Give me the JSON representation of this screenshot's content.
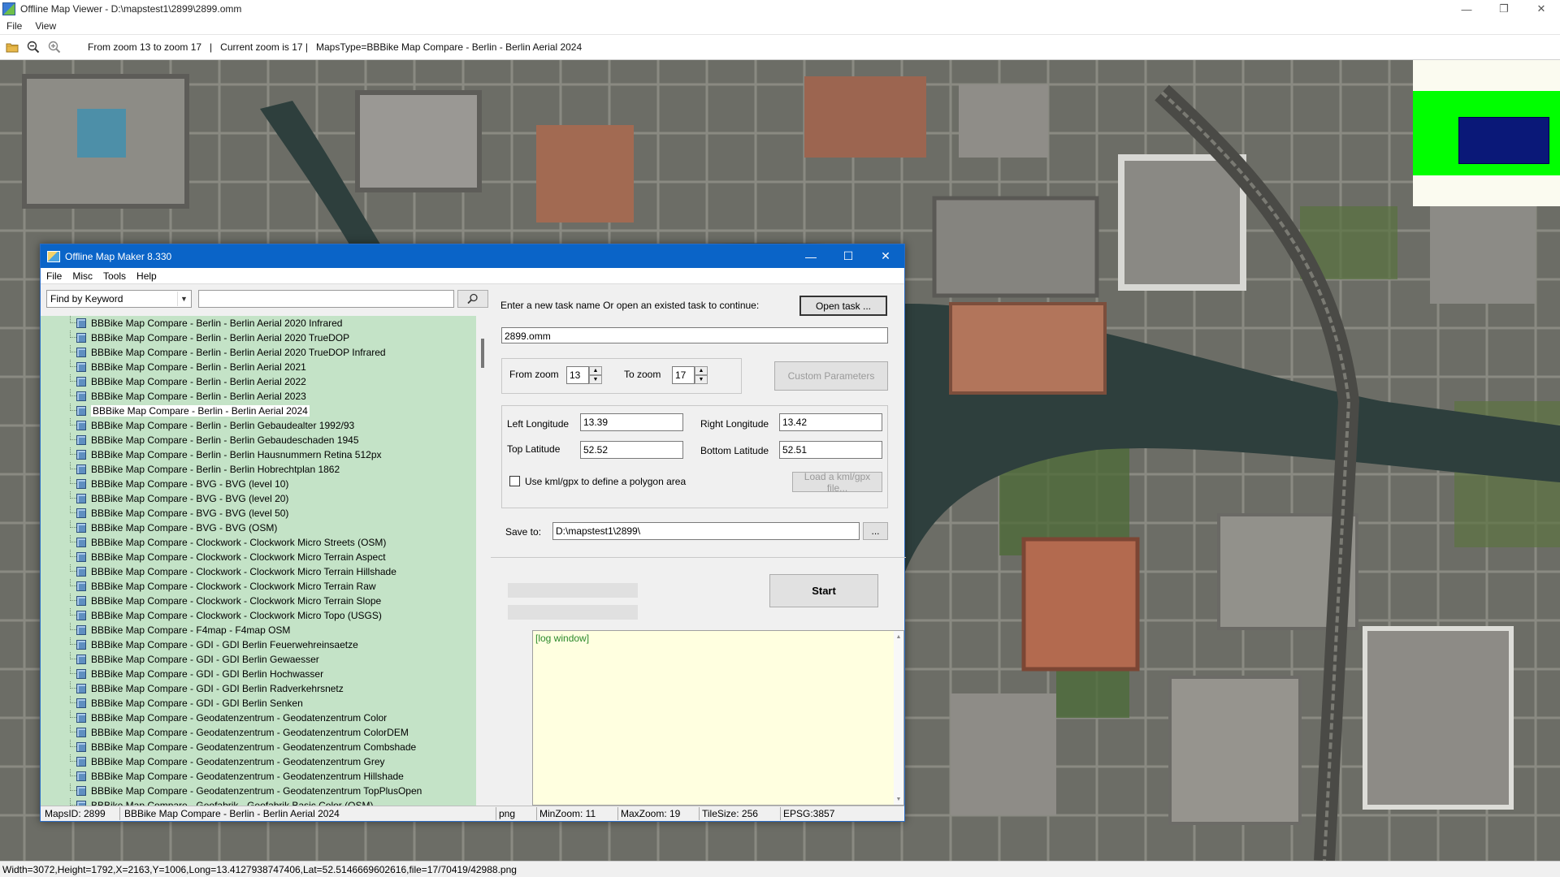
{
  "viewer": {
    "title": "Offline Map Viewer - D:\\mapstest1\\2899\\2899.omm",
    "menu": [
      "File",
      "View"
    ],
    "toolbar_info": "From zoom 13 to zoom 17   |   Current zoom is 17 |   MapsType=BBBike Map Compare - Berlin - Berlin Aerial 2024",
    "status": "Width=3072,Height=1792,X=2163,Y=1006,Long=13.4127938747406,Lat=52.5146669602616,file=17/70419/42988.png"
  },
  "dialog": {
    "title": "Offline Map Maker 8.330",
    "menu": [
      "File",
      "Misc",
      "Tools",
      "Help"
    ],
    "search": {
      "mode": "Find by Keyword",
      "value": ""
    },
    "tree_items": [
      "BBBike Map Compare - Berlin - Berlin Aerial 2020 Infrared",
      "BBBike Map Compare - Berlin - Berlin Aerial 2020 TrueDOP",
      "BBBike Map Compare - Berlin - Berlin Aerial 2020 TrueDOP Infrared",
      "BBBike Map Compare - Berlin - Berlin Aerial 2021",
      "BBBike Map Compare - Berlin - Berlin Aerial 2022",
      "BBBike Map Compare - Berlin - Berlin Aerial 2023",
      "BBBike Map Compare - Berlin - Berlin Aerial 2024",
      "BBBike Map Compare - Berlin - Berlin Gebaudealter 1992/93",
      "BBBike Map Compare - Berlin - Berlin Gebaudeschaden 1945",
      "BBBike Map Compare - Berlin - Berlin Hausnummern Retina 512px",
      "BBBike Map Compare - Berlin - Berlin Hobrechtplan 1862",
      "BBBike Map Compare - BVG - BVG (level 10)",
      "BBBike Map Compare - BVG - BVG (level 20)",
      "BBBike Map Compare - BVG - BVG (level 50)",
      "BBBike Map Compare - BVG - BVG (OSM)",
      "BBBike Map Compare - Clockwork - Clockwork Micro Streets (OSM)",
      "BBBike Map Compare - Clockwork - Clockwork Micro Terrain Aspect",
      "BBBike Map Compare - Clockwork - Clockwork Micro Terrain Hillshade",
      "BBBike Map Compare - Clockwork - Clockwork Micro Terrain Raw",
      "BBBike Map Compare - Clockwork - Clockwork Micro Terrain Slope",
      "BBBike Map Compare - Clockwork - Clockwork Micro Topo (USGS)",
      "BBBike Map Compare - F4map - F4map OSM",
      "BBBike Map Compare - GDI - GDI Berlin Feuerwehreinsaetze",
      "BBBike Map Compare - GDI - GDI Berlin Gewaesser",
      "BBBike Map Compare - GDI - GDI Berlin Hochwasser",
      "BBBike Map Compare - GDI - GDI Berlin Radverkehrsnetz",
      "BBBike Map Compare - GDI - GDI Berlin Senken",
      "BBBike Map Compare - Geodatenzentrum - Geodatenzentrum Color",
      "BBBike Map Compare - Geodatenzentrum - Geodatenzentrum ColorDEM",
      "BBBike Map Compare - Geodatenzentrum - Geodatenzentrum Combshade",
      "BBBike Map Compare - Geodatenzentrum - Geodatenzentrum Grey",
      "BBBike Map Compare - Geodatenzentrum - Geodatenzentrum Hillshade",
      "BBBike Map Compare - Geodatenzentrum - Geodatenzentrum TopPlusOpen",
      "BBBike Map Compare - Geofabrik - Geofabrik Basic Color (OSM)"
    ],
    "selected_item": "BBBike Map Compare - Berlin - Berlin Aerial 2024",
    "task_prompt": "Enter a new task name Or open an existed task to continue:",
    "open_task_label": "Open task ...",
    "task_name": "2899.omm",
    "from_zoom_label": "From zoom",
    "from_zoom": "13",
    "to_zoom_label": "To zoom",
    "to_zoom": "17",
    "custom_params_label": "Custom Parameters",
    "left_lon_label": "Left Longitude",
    "left_lon": "13.39",
    "right_lon_label": "Right Longitude",
    "right_lon": "13.42",
    "top_lat_label": "Top Latitude",
    "top_lat": "52.52",
    "bottom_lat_label": "Bottom Latitude",
    "bottom_lat": "52.51",
    "kml_label": "Use kml/gpx to define a polygon area",
    "load_kml_label": "Load a kml/gpx file...",
    "save_to_label": "Save to:",
    "save_to": "D:\\mapstest1\\2899\\",
    "browse_label": "...",
    "start_label": "Start",
    "log_text": "[log window]",
    "status": {
      "maps_id": "MapsID: 2899",
      "map_name": "BBBike Map Compare - Berlin - Berlin Aerial 2024",
      "format": "png",
      "min_zoom": "MinZoom: 11",
      "max_zoom": "MaxZoom: 19",
      "tile_size": "TileSize: 256",
      "epsg": "EPSG:3857"
    }
  }
}
